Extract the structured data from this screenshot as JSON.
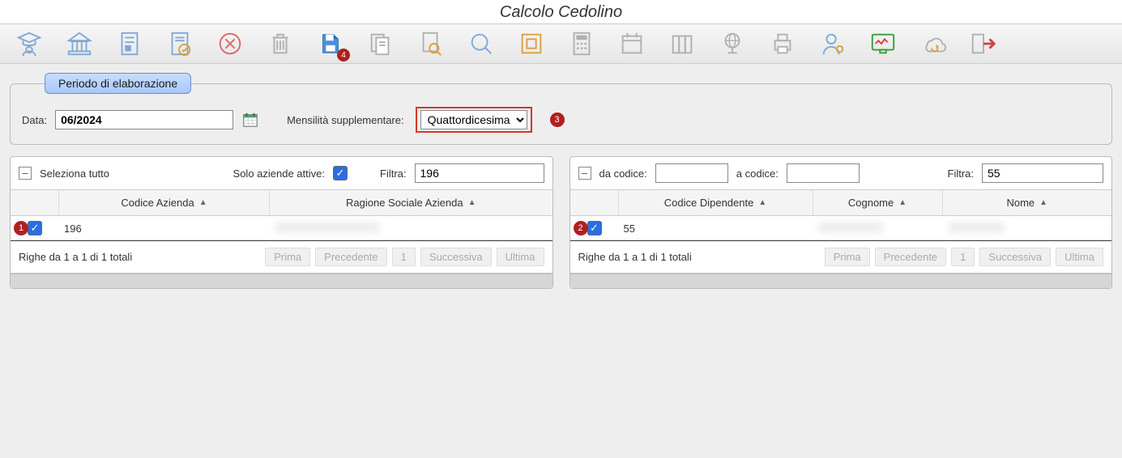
{
  "window": {
    "title": "Calcolo Cedolino"
  },
  "toolbar": {
    "icons": [
      "graduate-icon",
      "bank-icon",
      "file-list-icon",
      "file-check-icon",
      "cancel-circle-icon",
      "trash-icon",
      "save-icon",
      "copy-doc-icon",
      "search-doc-icon",
      "magnifier-icon",
      "square-target-icon",
      "calculator-icon",
      "calendar-icon",
      "archive-icon",
      "globe-icon",
      "printer-icon",
      "user-gear-icon",
      "monitor-chart-icon",
      "cloud-sync-icon",
      "exit-icon"
    ],
    "save_badge": "4"
  },
  "period": {
    "legend": "Periodo di elaborazione",
    "date_label": "Data:",
    "date_value": "06/2024",
    "supp_label": "Mensilità supplementare:",
    "supp_value": "Quattordicesima",
    "supp_marker": "3"
  },
  "left": {
    "select_all_label": "Seleziona tutto",
    "active_only_label": "Solo aziende attive:",
    "active_only_checked": true,
    "filter_label": "Filtra:",
    "filter_value": "196",
    "columns": {
      "c1": "Codice Azienda",
      "c2": "Ragione Sociale Azienda"
    },
    "row": {
      "checked": true,
      "code": "196",
      "name": ""
    },
    "row_marker": "1",
    "pager": {
      "info": "Righe da 1 a 1 di 1 totali",
      "first": "Prima",
      "prev": "Precedente",
      "page": "1",
      "next": "Successiva",
      "last": "Ultima"
    }
  },
  "right": {
    "from_code_label": "da codice:",
    "from_code_value": "",
    "to_code_label": "a codice:",
    "to_code_value": "",
    "filter_label": "Filtra:",
    "filter_value": "55",
    "columns": {
      "c1": "Codice Dipendente",
      "c2": "Cognome",
      "c3": "Nome"
    },
    "row": {
      "checked": true,
      "code": "55",
      "surname": "",
      "name": ""
    },
    "row_marker": "2",
    "pager": {
      "info": "Righe da 1 a 1 di 1 totali",
      "first": "Prima",
      "prev": "Precedente",
      "page": "1",
      "next": "Successiva",
      "last": "Ultima"
    }
  }
}
